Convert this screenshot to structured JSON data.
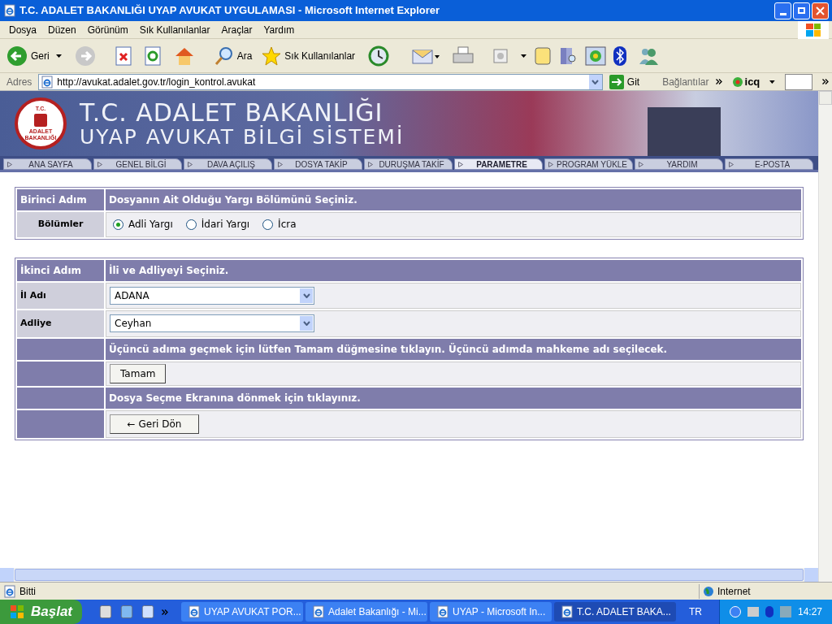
{
  "window": {
    "title": "T.C. ADALET BAKANLIĞI UYAP AVUKAT UYGULAMASI - Microsoft Internet Explorer"
  },
  "menu": [
    "Dosya",
    "Düzen",
    "Görünüm",
    "Sık Kullanılanlar",
    "Araçlar",
    "Yardım"
  ],
  "toolbar": {
    "back": "Geri",
    "search": "Ara",
    "favorites": "Sık Kullanılanlar"
  },
  "address": {
    "label": "Adres",
    "url": "http://avukat.adalet.gov.tr/login_kontrol.avukat",
    "go": "Git",
    "links": "Bağlantılar",
    "icq": "icq"
  },
  "banner": {
    "logo_top": "T.C.",
    "logo_bottom": "ADALET BAKANLIĞI",
    "title": "T.C. ADALET BAKANLIĞI",
    "subtitle": "UYAP AVUKAT BİLGİ SİSTEMİ"
  },
  "nav": [
    {
      "label": "ANA SAYFA",
      "selected": false
    },
    {
      "label": "GENEL BİLGİ",
      "selected": false
    },
    {
      "label": "DAVA AÇILIŞ",
      "selected": false
    },
    {
      "label": "DOSYA TAKİP",
      "selected": false
    },
    {
      "label": "DURUŞMA TAKİF",
      "selected": false
    },
    {
      "label": "PARAMETRE",
      "selected": true
    },
    {
      "label": "PROGRAM YÜKLE",
      "selected": false
    },
    {
      "label": "YARDIM",
      "selected": false
    },
    {
      "label": "E-POSTA",
      "selected": false
    }
  ],
  "step1": {
    "step": "Birinci Adım",
    "heading": "Dosyanın Ait Olduğu Yargı Bölümünü Seçiniz.",
    "row_label": "Bölümler",
    "options": [
      {
        "label": "Adli Yargı",
        "selected": true
      },
      {
        "label": "İdari Yargı",
        "selected": false
      },
      {
        "label": "İcra",
        "selected": false
      }
    ]
  },
  "step2": {
    "step": "İkinci Adım",
    "heading": "İli ve Adliyeyi Seçiniz.",
    "fields": [
      {
        "label": "İl Adı",
        "value": "ADANA"
      },
      {
        "label": "Adliye",
        "value": "Ceyhan"
      }
    ],
    "info": "Üçüncü adıma geçmek için lütfen Tamam düğmesine tıklayın. Üçüncü adımda mahkeme adı seçilecek.",
    "ok_button": "Tamam",
    "back_info": "Dosya Seçme Ekranına dönmek için tıklayınız.",
    "back_button": "← Geri Dön"
  },
  "status": {
    "text": "Bitti",
    "zone": "Internet"
  },
  "taskbar": {
    "start": "Başlat",
    "tasks": [
      {
        "label": "UYAP AVUKAT POR...",
        "selected": false
      },
      {
        "label": "Adalet Bakanlığı - Mi...",
        "selected": false
      },
      {
        "label": "UYAP - Microsoft In...",
        "selected": false
      },
      {
        "label": "T.C. ADALET BAKA...",
        "selected": true
      }
    ],
    "lang": "TR",
    "clock": "14:27"
  }
}
